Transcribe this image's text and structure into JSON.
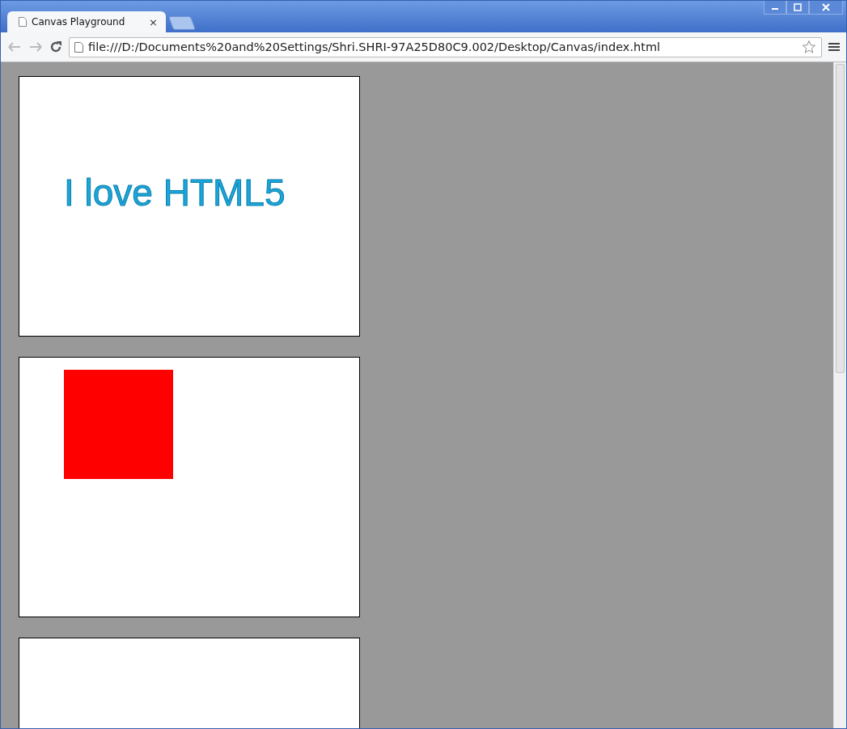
{
  "tabs": [
    {
      "title": "Canvas Playground",
      "close": "×",
      "selected": true
    }
  ],
  "address_bar": {
    "url": "file:///D:/Documents%20and%20Settings/Shri.SHRI-97A25D80C9.002/Desktop/Canvas/index.html"
  },
  "canvases": [
    {
      "kind": "text",
      "text": "I love HTML5",
      "color": "#1aa6dc"
    },
    {
      "kind": "rect",
      "color": "#ff0000"
    },
    {
      "kind": "blank"
    }
  ]
}
